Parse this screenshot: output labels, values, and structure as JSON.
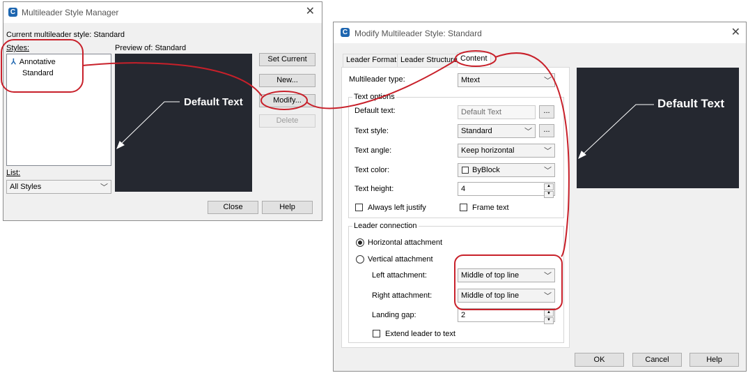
{
  "manager": {
    "title": "Multileader Style Manager",
    "current_label": "Current multileader style: Standard",
    "styles_label": "Styles:",
    "preview_label": "Preview of: Standard",
    "styles": [
      "Annotative",
      "Standard"
    ],
    "list_label": "List:",
    "list_value": "All Styles",
    "buttons": {
      "set_current": "Set Current",
      "new": "New...",
      "modify": "Modify...",
      "delete": "Delete",
      "close": "Close",
      "help": "Help"
    },
    "preview_text": "Default Text"
  },
  "modify": {
    "title": "Modify Multileader Style: Standard",
    "tabs": [
      "Leader Format",
      "Leader Structure",
      "Content"
    ],
    "multileader_type_label": "Multileader type:",
    "multileader_type_value": "Mtext",
    "text_options_title": "Text options",
    "default_text_label": "Default text:",
    "default_text_value": "Default Text",
    "text_style_label": "Text style:",
    "text_style_value": "Standard",
    "text_angle_label": "Text angle:",
    "text_angle_value": "Keep horizontal",
    "text_color_label": "Text color:",
    "text_color_value": "ByBlock",
    "text_height_label": "Text height:",
    "text_height_value": "4",
    "always_left_justify": "Always left justify",
    "frame_text": "Frame text",
    "leader_connection_title": "Leader connection",
    "horizontal_attachment": "Horizontal attachment",
    "vertical_attachment": "Vertical attachment",
    "left_attachment_label": "Left attachment:",
    "left_attachment_value": "Middle of top line",
    "right_attachment_label": "Right attachment:",
    "right_attachment_value": "Middle of top line",
    "landing_gap_label": "Landing gap:",
    "landing_gap_value": "2",
    "extend_leader": "Extend leader to text",
    "ellipsis": "...",
    "buttons": {
      "ok": "OK",
      "cancel": "Cancel",
      "help": "Help"
    },
    "preview_text": "Default Text"
  },
  "colors": {
    "annotation_red": "#c8202a",
    "preview_bg": "#252830",
    "icon_blue": "#1e66b0"
  }
}
